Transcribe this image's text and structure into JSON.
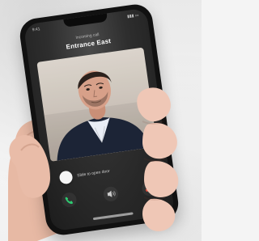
{
  "screen": {
    "status": {
      "time": "9:41",
      "icons": "▮▮▮ ▭"
    },
    "subtitle": "Incoming call",
    "title": "Entrance East",
    "unlock_label": "Slide to open door",
    "controls": [
      {
        "name": "accept-call",
        "icon": "phone-icon"
      },
      {
        "name": "speaker",
        "icon": "speaker-icon"
      },
      {
        "name": "decline-call",
        "icon": "end-call-icon"
      }
    ]
  },
  "colors": {
    "accept": "#2ecc71",
    "decline": "#e74c3c",
    "screen_bg": "#2e2e2e",
    "jacket": "#1c2436",
    "shirt": "#e9edf5"
  }
}
